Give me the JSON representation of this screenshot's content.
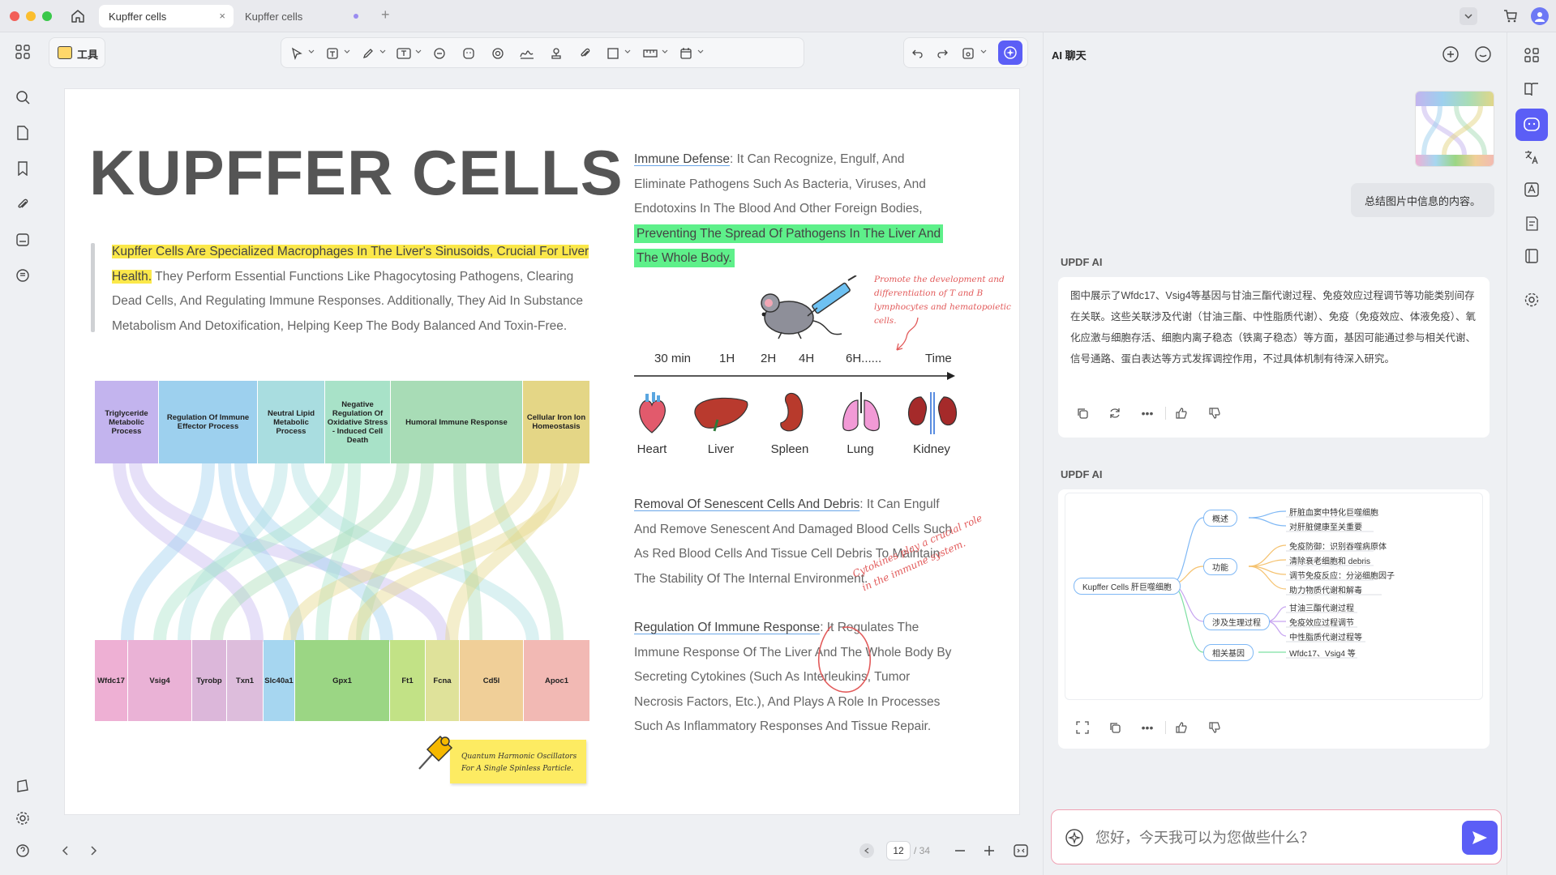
{
  "tabs": [
    {
      "label": "Kupffer cells",
      "active": true
    },
    {
      "label": "Kupffer cells",
      "active": false
    }
  ],
  "toolbar": {
    "tools_label": "工具"
  },
  "document": {
    "title": "KUPFFER CELLS",
    "intro_highlight_1": "Kupffer Cells Are Specialized Macrophages In The Liver's Sinusoids, Crucial For Liver",
    "intro_highlight_2": "Health.",
    "intro_rest_1": " They Perform Essential Functions Like Phagocytosing Pathogens, Clearing",
    "intro_rest_2": "Dead Cells, And Regulating Immune Responses. Additionally, They Aid In Substance",
    "intro_rest_3": "Metabolism And Detoxification, Helping Keep The Body Balanced And Toxin-Free.",
    "categories": [
      {
        "label": "Triglyceride Metabolic Process",
        "color": "#c3b4ee"
      },
      {
        "label": "Regulation Of Immune Effector Process",
        "color": "#9dd0ee"
      },
      {
        "label": "Neutral Lipid Metabolic Process",
        "color": "#a9dde0"
      },
      {
        "label": "Negative Regulation Of Oxidative Stress - Induced Cell Death",
        "color": "#a8e2c8"
      },
      {
        "label": "Humoral Immune Response",
        "color": "#a8dcb6"
      },
      {
        "label": "Cellular Iron Ion Homeostasis",
        "color": "#e4d686"
      }
    ],
    "genes": [
      {
        "label": "Wfdc17",
        "color": "#eeb0d4"
      },
      {
        "label": "Vsig4",
        "color": "#eab2d6"
      },
      {
        "label": "Tyrobp",
        "color": "#dcb7da"
      },
      {
        "label": "Txn1",
        "color": "#ddbddc"
      },
      {
        "label": "Slc40a1",
        "color": "#a6d6f0"
      },
      {
        "label": "Gpx1",
        "color": "#9bd684"
      },
      {
        "label": "Ft1",
        "color": "#c2e286"
      },
      {
        "label": "Fcna",
        "color": "#dfe29a"
      },
      {
        "label": "Cd5l",
        "color": "#f0cf98"
      },
      {
        "label": "Apoc1",
        "color": "#f2b9b4"
      }
    ],
    "sticky_note": "Quantum Harmonic Oscillators For A Single Spinless Particle.",
    "immune_defense_term": "Immune Defense",
    "immune_defense_1": ": It Can Recognize, Engulf, And",
    "immune_defense_2": "Eliminate Pathogens Such As Bacteria, Viruses, And",
    "immune_defense_3": "Endotoxins In The Blood And Other Foreign Bodies,",
    "immune_defense_hl_1": "Preventing The Spread Of Pathogens In The Liver And",
    "immune_defense_hl_2": "The Whole Body.",
    "mouse_note": "Promote the development and differentiation of T and B lymphocytes and hematopoietic cells.",
    "timeline": [
      "30 min",
      "1H",
      "2H",
      "4H",
      "6H......",
      "Time"
    ],
    "organs": [
      "Heart",
      "Liver",
      "Spleen",
      "Lung",
      "Kidney"
    ],
    "removal_term": "Removal Of Senescent Cells And Debris",
    "removal_1": ": It Can Engulf",
    "removal_2": "And Remove Senescent And Damaged Blood Cells Such",
    "removal_3": "As Red Blood Cells And Tissue Cell Debris To Maintain",
    "removal_4": "The Stability Of The Internal Environment.",
    "cytokine_note_1": "Cytokines play a crucial role",
    "cytokine_note_2": "in the immune system.",
    "regulation_term": "Regulation Of Immune Response",
    "regulation_1": ": It Regulates The",
    "regulation_2": "Immune Response Of The Liver And The Whole Body By",
    "regulation_3": "Secreting Cytokines (Such As Interleukins, Tumor",
    "regulation_4": "Necrosis Factors, Etc.), And Plays A Role In Processes",
    "regulation_5": "Such As Inflammatory Responses And Tissue Repair."
  },
  "pagination": {
    "current": "12",
    "total": "/ 34"
  },
  "chat": {
    "title": "AI 聊天",
    "user_message": "总结图片中信息的内容。",
    "ai_name_1": "UPDF AI",
    "ai_response": "图中展示了Wfdc17、Vsig4等基因与甘油三酯代谢过程、免疫效应过程调节等功能类别间存在关联。这些关联涉及代谢（甘油三酯、中性脂质代谢）、免疫（免疫效应、体液免疫）、氧化应激与细胞存活、细胞内离子稳态（铁离子稳态）等方面，基因可能通过参与相关代谢、信号通路、蛋白表达等方式发挥调控作用，不过具体机制有待深入研究。",
    "ai_name_2": "UPDF AI",
    "mindmap": {
      "root": "Kupffer Cells 肝巨噬细胞",
      "branches": [
        {
          "label": "概述",
          "leaves": [
            "肝脏血窦中特化巨噬细胞",
            "对肝脏健康至关重要"
          ]
        },
        {
          "label": "功能",
          "leaves": [
            "免疫防御：识别吞噬病原体",
            "清除衰老细胞和 debris",
            "调节免疫反应：分泌细胞因子",
            "助力物质代谢和解毒"
          ]
        },
        {
          "label": "涉及生理过程",
          "leaves": [
            "甘油三酯代谢过程",
            "免疫效应过程调节",
            "中性脂质代谢过程等"
          ]
        },
        {
          "label": "相关基因",
          "leaves": [
            "Wfdc17、Vsig4 等"
          ]
        }
      ]
    },
    "input_placeholder": "您好，今天我可以为您做些什么？"
  },
  "colors": {
    "accent": "#5b5ef6",
    "highlight_yellow": "#fbe84a",
    "highlight_green": "#5ef08a",
    "annotation_red": "#e25b5b"
  }
}
